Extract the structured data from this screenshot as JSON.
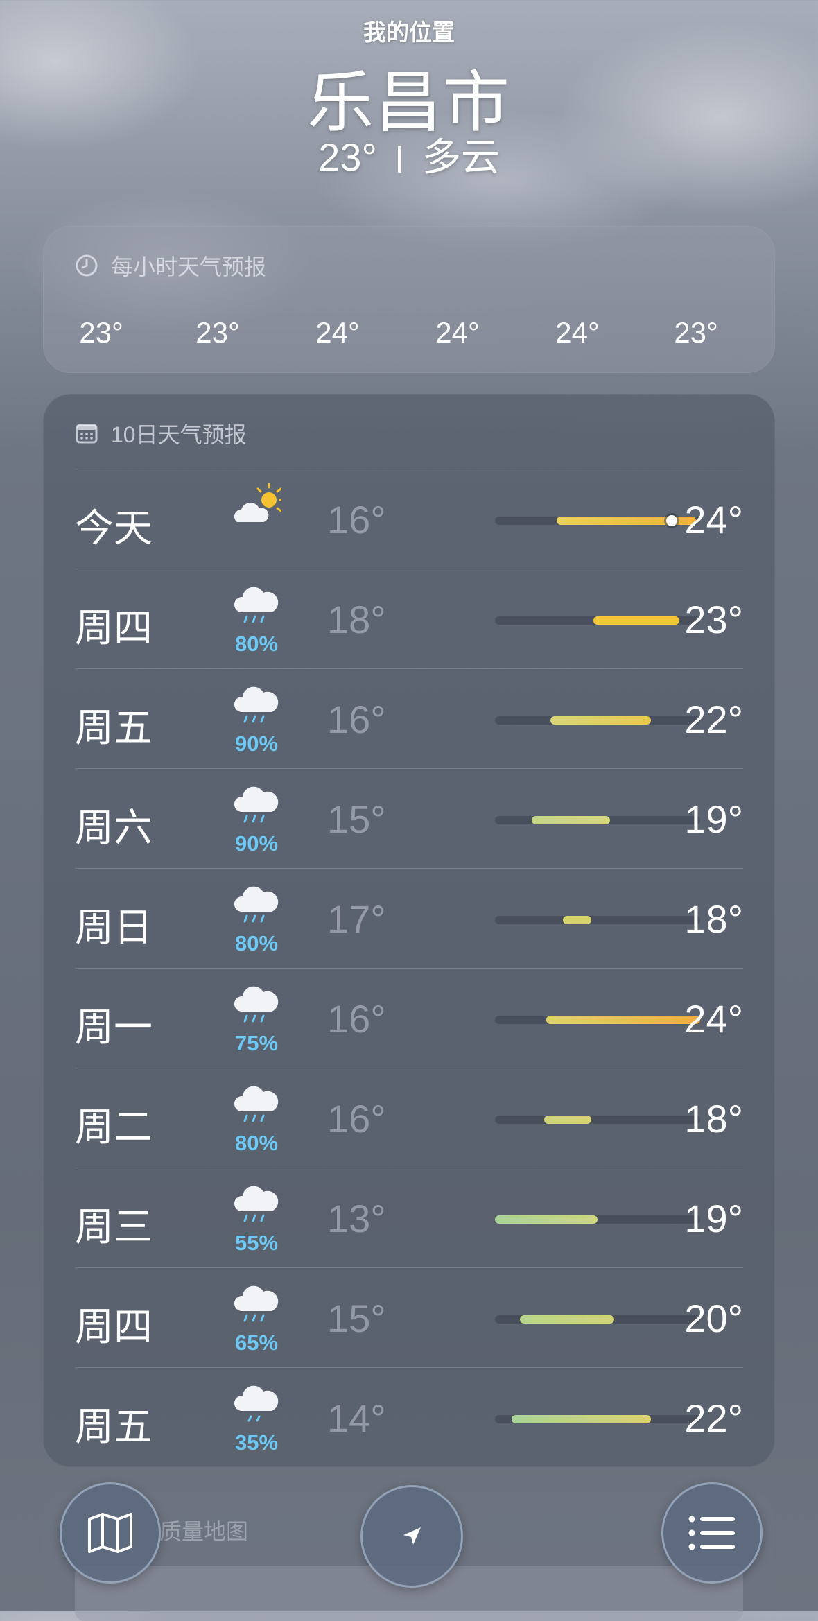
{
  "header": {
    "location_label": "我的位置",
    "city": "乐昌市",
    "temp": "23°",
    "condition": "多云"
  },
  "hourly": {
    "title": "每小时天气预报",
    "temps": [
      "23°",
      "23°",
      "24°",
      "24°",
      "24°",
      "23°"
    ]
  },
  "daily": {
    "title": "10日天气预报",
    "days": [
      {
        "name": "今天",
        "icon": "partly-sunny-icon",
        "precip": "",
        "low": "16°",
        "high": "24°",
        "bar_start": 0.3,
        "bar_end": 0.98,
        "bar_color_from": "#e8d35a",
        "bar_color_to": "#f2b03a",
        "current": 0.86
      },
      {
        "name": "周四",
        "icon": "rain-cloud-icon",
        "precip": "80%",
        "low": "18°",
        "high": "23°",
        "bar_start": 0.48,
        "bar_end": 0.9,
        "bar_color_from": "#f2c73c",
        "bar_color_to": "#f2c73c"
      },
      {
        "name": "周五",
        "icon": "rain-cloud-icon",
        "precip": "90%",
        "low": "16°",
        "high": "22°",
        "bar_start": 0.27,
        "bar_end": 0.76,
        "bar_color_from": "#d9d77a",
        "bar_color_to": "#e8c94e"
      },
      {
        "name": "周六",
        "icon": "rain-cloud-icon",
        "precip": "90%",
        "low": "15°",
        "high": "19°",
        "bar_start": 0.18,
        "bar_end": 0.56,
        "bar_color_from": "#c5d68a",
        "bar_color_to": "#d7d77e"
      },
      {
        "name": "周日",
        "icon": "rain-cloud-icon",
        "precip": "80%",
        "low": "17°",
        "high": "18°",
        "bar_start": 0.33,
        "bar_end": 0.47,
        "bar_color_from": "#d6d46c",
        "bar_color_to": "#d6d46c"
      },
      {
        "name": "周一",
        "icon": "rain-cloud-icon",
        "precip": "75%",
        "low": "16°",
        "high": "24°",
        "bar_start": 0.25,
        "bar_end": 1.0,
        "bar_color_from": "#dcd468",
        "bar_color_to": "#f2ac3c"
      },
      {
        "name": "周二",
        "icon": "rain-cloud-icon",
        "precip": "80%",
        "low": "16°",
        "high": "18°",
        "bar_start": 0.24,
        "bar_end": 0.47,
        "bar_color_from": "#cfd47a",
        "bar_color_to": "#d8d372"
      },
      {
        "name": "周三",
        "icon": "rain-cloud-icon",
        "precip": "55%",
        "low": "13°",
        "high": "19°",
        "bar_start": 0.0,
        "bar_end": 0.5,
        "bar_color_from": "#a9d39a",
        "bar_color_to": "#cfd684"
      },
      {
        "name": "周四",
        "icon": "rain-cloud-icon",
        "precip": "65%",
        "low": "15°",
        "high": "20°",
        "bar_start": 0.12,
        "bar_end": 0.58,
        "bar_color_from": "#b7d58f",
        "bar_color_to": "#d3d477"
      },
      {
        "name": "周五",
        "icon": "light-rain-cloud-icon",
        "precip": "35%",
        "low": "14°",
        "high": "22°",
        "bar_start": 0.08,
        "bar_end": 0.76,
        "bar_color_from": "#a9d39a",
        "bar_color_to": "#dcd26c"
      }
    ]
  },
  "next_card": {
    "label": "质量地图"
  },
  "toolbar": {
    "map_icon": "map-icon",
    "location_icon": "location-arrow-icon",
    "list_icon": "list-icon"
  }
}
